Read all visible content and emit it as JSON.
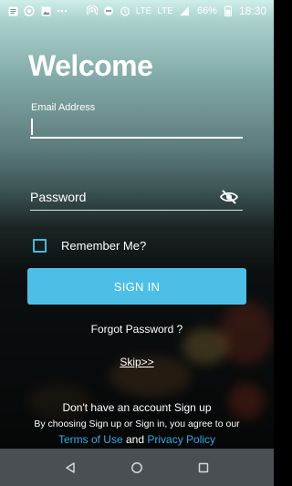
{
  "status_bar": {
    "left_icons": [
      "message-icon",
      "whatsapp-icon",
      "image-icon",
      "more-dots-icon"
    ],
    "right_icons": [
      "hotspot-icon",
      "do-not-disturb-icon",
      "alarm-icon",
      "lte-call-icon",
      "lte-signal-icon",
      "signal-icon"
    ],
    "lte1": "LTE",
    "lte2": "LTE",
    "battery": "66%",
    "time": "18:30"
  },
  "login": {
    "title": "Welcome",
    "email_label": "Email Address",
    "email_value": "",
    "password_placeholder": "Password",
    "remember_label": "Remember Me?",
    "remember_checked": false,
    "signin_label": "SIGN IN",
    "forgot_label": "Forgot Password ?",
    "skip_label": "Skip>>",
    "signup_text": "Don't have an account Sign up",
    "consent_text": "By choosing Sign up or Sign in, you agree to our",
    "terms_label": "Terms of Use",
    "and_label": "and",
    "privacy_label": "Privacy Policy"
  },
  "colors": {
    "accent": "#4dbfe6",
    "link": "#34a8e8",
    "nav_bar": "#4a4f54"
  },
  "nav": {
    "buttons": [
      "back-icon",
      "home-icon",
      "recents-icon"
    ]
  }
}
